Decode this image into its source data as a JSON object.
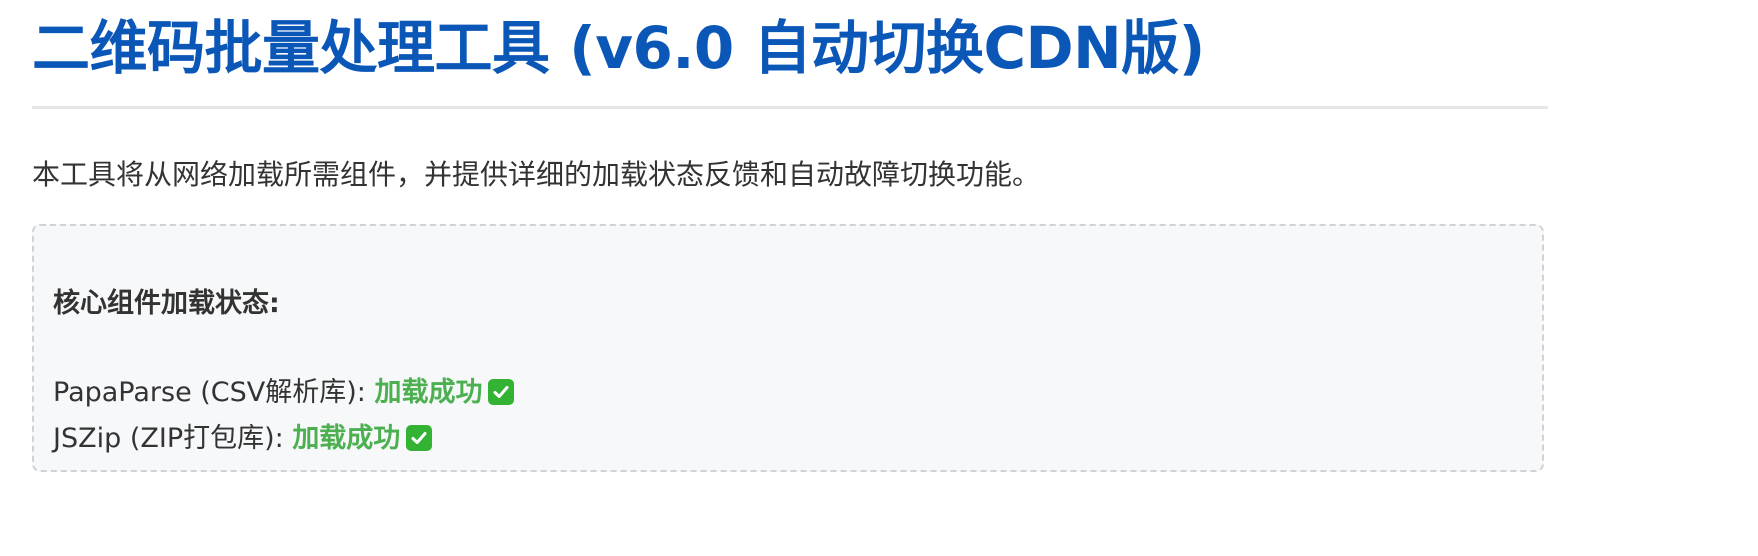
{
  "header": {
    "title": "二维码批量处理工具 (v6.0 自动切换CDN版)"
  },
  "intro": {
    "text": "本工具将从网络加载所需组件，并提供详细的加载状态反馈和自动故障切换功能。"
  },
  "status_panel": {
    "heading": "核心组件加载状态:",
    "components": [
      {
        "name": "PapaParse (CSV解析库): ",
        "status": "加载成功",
        "icon": "check-mark-icon"
      },
      {
        "name": "JSZip (ZIP打包库): ",
        "status": "加载成功",
        "icon": "check-mark-icon"
      }
    ]
  },
  "colors": {
    "title": "#0b57b8",
    "success": "#4caf50",
    "check_bg": "#34b233",
    "panel_bg": "#f7f8fa",
    "panel_border": "#cfd3d8"
  }
}
